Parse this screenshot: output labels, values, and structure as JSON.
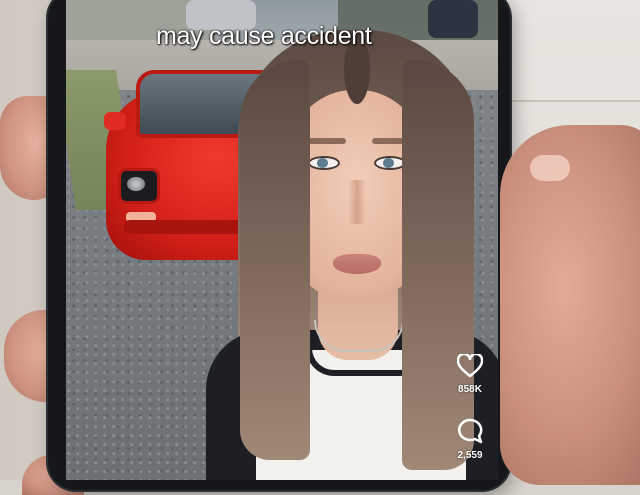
{
  "scene": {
    "description_tags": [
      "hand-holding-phone",
      "short-video-app",
      "selfie-video"
    ]
  },
  "video": {
    "caption": "may cause accident"
  },
  "actions": {
    "like_icon": "heart-icon",
    "like_count": "858K",
    "comment_icon": "comment-bubble-icon",
    "comment_count": "2,559"
  },
  "colors": {
    "car": "#d21f17",
    "caption_text": "#ffffff"
  }
}
